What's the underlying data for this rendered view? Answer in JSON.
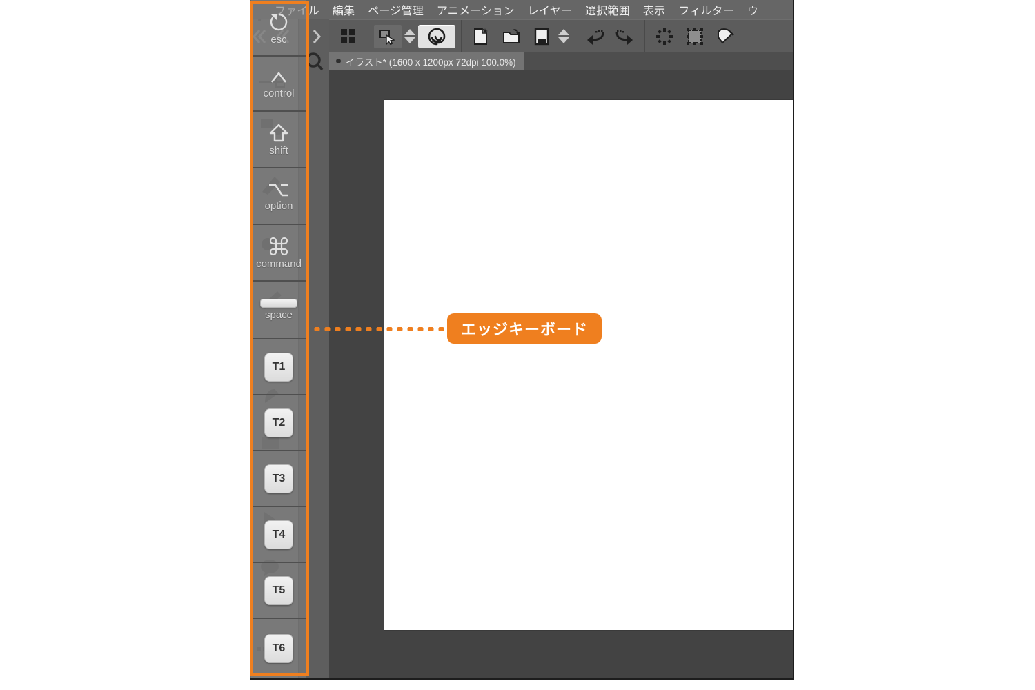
{
  "app": {
    "menubar": [
      {
        "label": "ファイル",
        "name": "menu-file"
      },
      {
        "label": "編集",
        "name": "menu-edit"
      },
      {
        "label": "ページ管理",
        "name": "menu-page-manage"
      },
      {
        "label": "アニメーション",
        "name": "menu-animation"
      },
      {
        "label": "レイヤー",
        "name": "menu-layer"
      },
      {
        "label": "選択範囲",
        "name": "menu-selection"
      },
      {
        "label": "表示",
        "name": "menu-view"
      },
      {
        "label": "フィルター",
        "name": "menu-filter"
      },
      {
        "label": "ウ",
        "name": "menu-window"
      }
    ],
    "toolbar": {
      "icons": [
        {
          "name": "grid-view-icon",
          "glyph": "grid"
        },
        {
          "name": "quick-access-icon",
          "glyph": "quickaccess"
        },
        {
          "name": "spinner-stepper",
          "glyph": "spinner"
        },
        {
          "name": "brush-swirl-icon",
          "glyph": "swirl"
        },
        {
          "name": "new-document-icon",
          "glyph": "newdoc"
        },
        {
          "name": "open-folder-icon",
          "glyph": "openfolder"
        },
        {
          "name": "save-icon",
          "glyph": "save"
        },
        {
          "name": "page-stepper",
          "glyph": "spinner"
        },
        {
          "name": "undo-icon",
          "glyph": "undo"
        },
        {
          "name": "redo-icon",
          "glyph": "redo"
        },
        {
          "name": "deselect-icon",
          "glyph": "deselect"
        },
        {
          "name": "transform-selection-icon",
          "glyph": "transform"
        },
        {
          "name": "fill-bucket-icon",
          "glyph": "fill"
        }
      ]
    },
    "document_tab": {
      "title": "イラスト* (1600 x 1200px 72dpi 100.0%)",
      "modified_dot": "●"
    }
  },
  "edge_keyboard": {
    "keys": [
      {
        "label": "esc",
        "glyph": "esc-rotate-icon",
        "type": "glyph",
        "name": "edge-key-esc"
      },
      {
        "label": "control",
        "glyph": "^",
        "type": "glyph",
        "name": "edge-key-control"
      },
      {
        "label": "shift",
        "glyph": "⇧",
        "type": "glyph",
        "name": "edge-key-shift"
      },
      {
        "label": "option",
        "glyph": "⌥",
        "type": "glyph",
        "name": "edge-key-option"
      },
      {
        "label": "command",
        "glyph": "⌘",
        "type": "glyph",
        "name": "edge-key-command"
      },
      {
        "label": "space",
        "glyph": "",
        "type": "spacebar",
        "name": "edge-key-space"
      },
      {
        "label": "",
        "glyph": "T1",
        "type": "tkey",
        "name": "edge-key-t1"
      },
      {
        "label": "",
        "glyph": "T2",
        "type": "tkey",
        "name": "edge-key-t2"
      },
      {
        "label": "",
        "glyph": "T3",
        "type": "tkey",
        "name": "edge-key-t3"
      },
      {
        "label": "",
        "glyph": "T4",
        "type": "tkey",
        "name": "edge-key-t4"
      },
      {
        "label": "",
        "glyph": "T5",
        "type": "tkey",
        "name": "edge-key-t5"
      },
      {
        "label": "",
        "glyph": "T6",
        "type": "tkey",
        "name": "edge-key-t6"
      }
    ]
  },
  "annotation": {
    "callout_label": "エッジキーボード",
    "accent_color": "#ef7f1f",
    "highlight_color": "#ef7f1f"
  },
  "palette": {
    "items": [
      {
        "name": "search-magnifier-icon"
      },
      {
        "name": "layout-squares-icon"
      },
      {
        "name": "gear-settings-icon"
      },
      {
        "name": "dot-sizes-icon"
      },
      {
        "name": "color-wheel-icon"
      },
      {
        "name": "color-set-icon"
      },
      {
        "name": "color-slider-icon"
      },
      {
        "name": "brush-preview-icon"
      },
      {
        "name": "brush-texture-icon"
      },
      {
        "name": "symmetry-icon"
      },
      {
        "name": "layer-thumbnail-icon"
      }
    ]
  }
}
